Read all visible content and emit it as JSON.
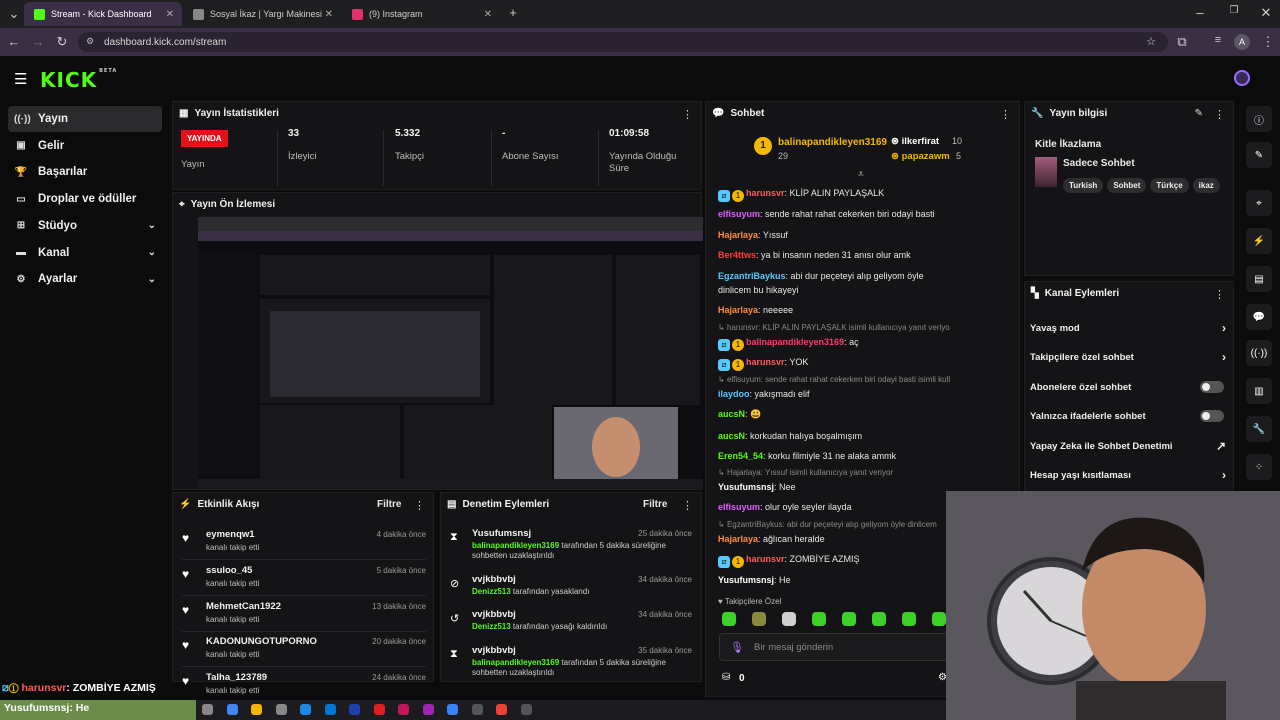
{
  "browser": {
    "tabs": [
      {
        "title": "Stream - Kick Dashboard",
        "active": true,
        "fav": "#53fc18"
      },
      {
        "title": "Sosyal İkaz | Yargı Makinesi",
        "active": false,
        "fav": "#888888"
      },
      {
        "title": "(9) Instagram",
        "active": false,
        "fav": "#e1306c"
      }
    ],
    "url": "dashboard.kick.com/stream",
    "profile_letter": "A"
  },
  "brand": {
    "logo": "KICK",
    "beta": "BETA",
    "accent": "#53fc18"
  },
  "sidebar": {
    "items": [
      {
        "label": "Yayın",
        "icon": "broadcast-icon",
        "active": true,
        "chevron": false
      },
      {
        "label": "Gelir",
        "icon": "revenue-icon",
        "active": false,
        "chevron": false
      },
      {
        "label": "Başarılar",
        "icon": "trophy-icon",
        "active": false,
        "chevron": false
      },
      {
        "label": "Droplar ve ödüller",
        "icon": "gift-icon",
        "active": false,
        "chevron": false
      },
      {
        "label": "Stüdyo",
        "icon": "studio-icon",
        "active": false,
        "chevron": true
      },
      {
        "label": "Kanal",
        "icon": "channel-icon",
        "active": false,
        "chevron": true
      },
      {
        "label": "Ayarlar",
        "icon": "gear-icon",
        "active": false,
        "chevron": true
      }
    ]
  },
  "stats": {
    "title": "Yayın İstatistikleri",
    "live_badge": "YAYINDA",
    "items": [
      {
        "value": "",
        "label": "Yayın"
      },
      {
        "value": "33",
        "label": "İzleyici"
      },
      {
        "value": "5.332",
        "label": "Takipçi"
      },
      {
        "value": "-",
        "label": "Abone Sayısı"
      },
      {
        "value": "01:09:58",
        "label": "Yayında Olduğu Süre"
      }
    ]
  },
  "preview": {
    "title": "Yayın Ön İzlemesi"
  },
  "activity": {
    "title": "Etkinlik Akışı",
    "filter": "Filtre",
    "items": [
      {
        "name": "eymenqw1",
        "action": "kanalı takip etti",
        "time": "4 dakika önce"
      },
      {
        "name": "ssuloo_45",
        "action": "kanalı takip etti",
        "time": "5 dakika önce"
      },
      {
        "name": "MehmetCan1922",
        "action": "kanalı takip etti",
        "time": "13 dakika önce"
      },
      {
        "name": "KADONUNGOTUPORNO",
        "action": "kanalı takip etti",
        "time": "20 dakika önce"
      },
      {
        "name": "Talha_123789",
        "action": "kanalı takip etti",
        "time": "24 dakika önce"
      }
    ]
  },
  "moderation": {
    "title": "Denetim Eylemleri",
    "filter": "Filtre",
    "items": [
      {
        "name": "Yusufumsnsj",
        "actor": "balinapandikleyen3169",
        "desc": "tarafından 5 dakika süreliğine sohbetten uzaklaştırıldı",
        "time": "25 dakika önce",
        "icon": "hourglass-icon"
      },
      {
        "name": "vvjkbbvbj",
        "actor": "Denizz513",
        "desc": "tarafından yasaklandı",
        "time": "34 dakika önce",
        "icon": "ban-icon"
      },
      {
        "name": "vvjkbbvbj",
        "actor": "Denizz513",
        "desc": "tarafından yasağı kaldırıldı",
        "time": "34 dakika önce",
        "icon": "undo-icon"
      },
      {
        "name": "vvjkbbvbj",
        "actor": "balinapandikleyen3169",
        "desc": "tarafından 5 dakika süreliğine sohbetten uzaklaştırıldı",
        "time": "35 dakika önce",
        "icon": "hourglass-icon"
      }
    ]
  },
  "chat": {
    "title": "Sohbet",
    "top_gifter": {
      "name": "balinapandikleyen3169",
      "count": "29",
      "rank": "1"
    },
    "gifters": [
      {
        "name": "ilkerfirat",
        "count": "10"
      },
      {
        "name": "papazawm",
        "count": "5"
      }
    ],
    "messages": [
      {
        "user": "harunsvr",
        "color": "#ff5a5a",
        "text": "KLİP ALIN PAYLAŞALK",
        "badges": true
      },
      {
        "user": "elfisuyum",
        "color": "#e05cff",
        "text": "sende rahat rahat cekerken biri odayi basti"
      },
      {
        "user": "Hajarlaya",
        "color": "#ff8c3a",
        "text": "Yıssuf"
      },
      {
        "user": "Ber4ttws",
        "color": "#ff3b3b",
        "text": "ya bi insanın neden 31 anısı olur amk"
      },
      {
        "user": "EgzantriBaykus",
        "color": "#58c8ff",
        "text": "abi dur peçeteyi alıp geliyom öyle dinlicem bu hikayeyi"
      },
      {
        "user": "Hajarlaya",
        "color": "#ff8c3a",
        "text": "neeeee"
      },
      {
        "reply": "harunsvr: KLİP ALIN PAYLAŞALK isimli kullanıcıya yanıt veriyor"
      },
      {
        "user": "balinapandikleyen3169",
        "color": "#ff3b6b",
        "text": "aç",
        "badges": true
      },
      {
        "user": "harunsvr",
        "color": "#ff5a5a",
        "text": "YOK",
        "badges": true
      },
      {
        "reply": "elfisuyum: sende rahat rahat cekerken biri odayi basti isimli kullanıcıya..."
      },
      {
        "user": "ilaydoo",
        "color": "#58c8ff",
        "text": "yakışmadı elif"
      },
      {
        "user": "aucsN",
        "color": "#53fc18",
        "text": "😃"
      },
      {
        "user": "aucsN",
        "color": "#53fc18",
        "text": "korkudan halıya boşalmışım"
      },
      {
        "user": "Eren54_54",
        "color": "#53fc18",
        "text": "korku filmiyle 31 ne alaka ammk"
      },
      {
        "reply": "Hajarlaya: Yıssuf isimli kullanıcıya yanıt veriyor"
      },
      {
        "user": "Yusufumsnsj",
        "color": "#ffffff",
        "text": "Nee"
      },
      {
        "user": "elfisuyum",
        "color": "#e05cff",
        "text": "olur oyle seyler ilayda"
      },
      {
        "reply": "EgzantriBaykus: abi dur peçeteyi alıp geliyom öyle dinlicem"
      },
      {
        "user": "Hajarlaya",
        "color": "#ff8c3a",
        "text": "ağlıcan heralde"
      },
      {
        "user": "harunsvr",
        "color": "#ff5a5a",
        "text": "ZOMBİYE AZMIŞ",
        "badges": true
      },
      {
        "user": "Yusufumsnsj",
        "color": "#ffffff",
        "text": "He"
      }
    ],
    "followers_only_label": "Takipçilere Özel",
    "input_placeholder": "Bir mesaj gönderin",
    "points": "0"
  },
  "stream_info": {
    "title": "Yayın bilgisi",
    "stream_title": "Kitle İkazlama",
    "category": "Sadece Sohbet",
    "tags": [
      "Turkish",
      "Sohbet",
      "Türkçe",
      "ikaz"
    ]
  },
  "channel_actions": {
    "title": "Kanal Eylemleri",
    "items": [
      {
        "label": "Yavaş mod",
        "control": "chevron"
      },
      {
        "label": "Takipçilere özel sohbet",
        "control": "chevron"
      },
      {
        "label": "Abonelere özel sohbet",
        "control": "toggle"
      },
      {
        "label": "Yalnızca ifadelerle sohbet",
        "control": "toggle"
      },
      {
        "label": "Yapay Zeka ile Sohbet Denetimi",
        "control": "external"
      },
      {
        "label": "Hesap yaşı kısıtlaması",
        "control": "chevron"
      }
    ]
  },
  "overlay": {
    "line1_user": "harunsvr",
    "line1_text": ": ZOMBİYE AZMIŞ",
    "line2_user": "Yusufumsnsj",
    "line2_text": ": He"
  }
}
